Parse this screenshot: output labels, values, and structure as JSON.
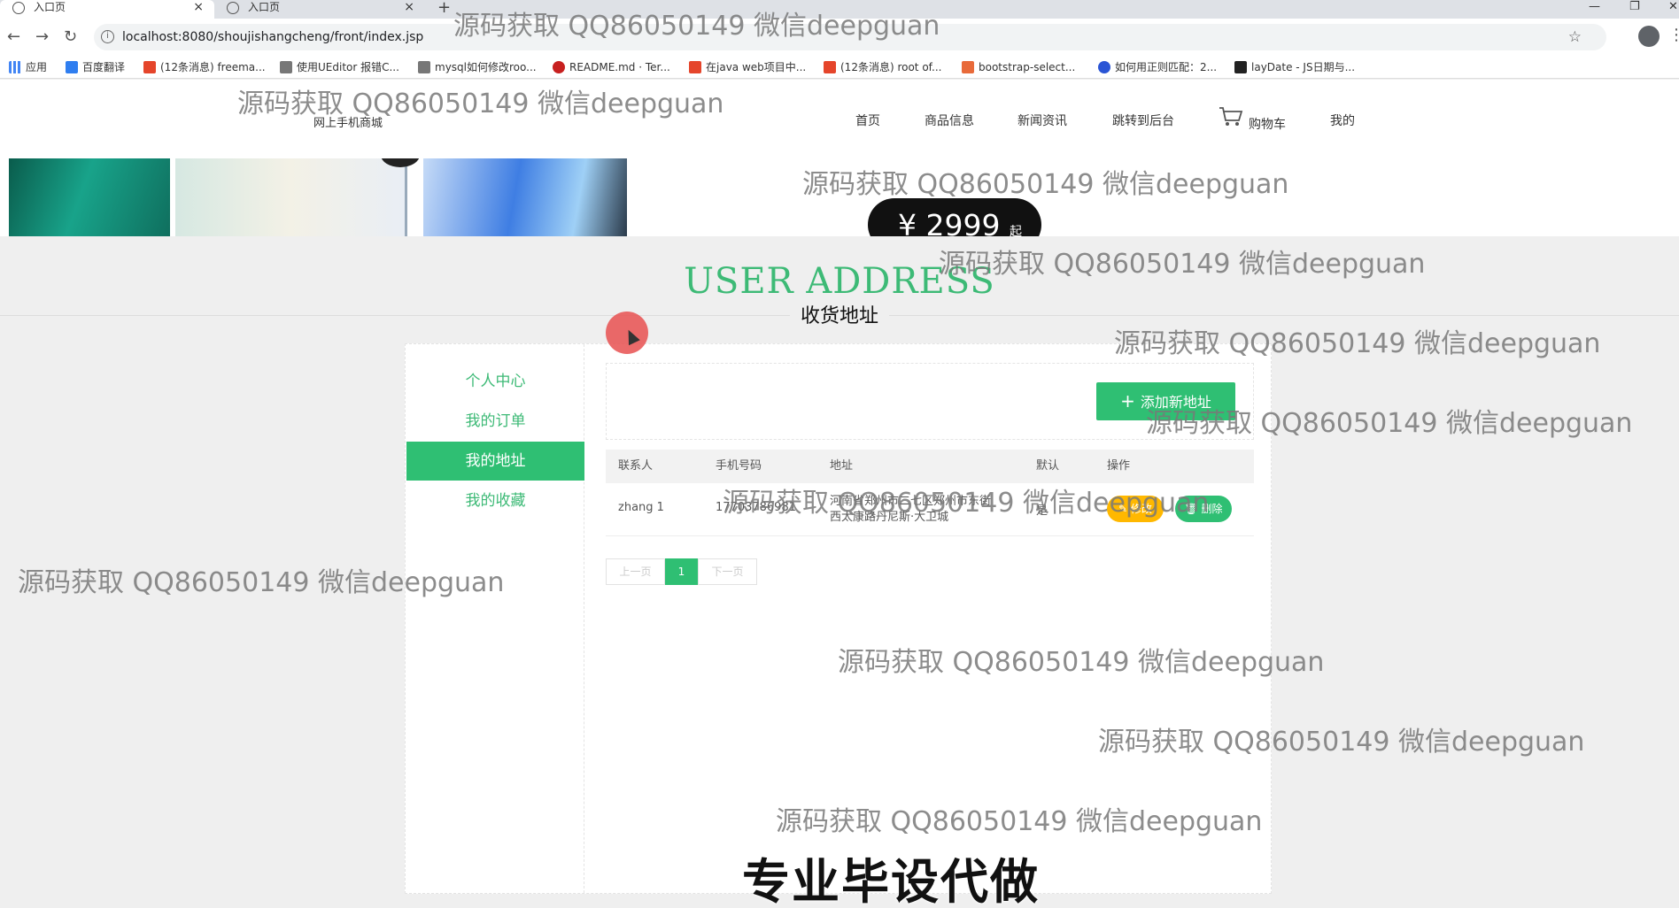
{
  "browser": {
    "tabs": [
      {
        "label": "入口页"
      },
      {
        "label": "入口页"
      }
    ],
    "url": "localhost:8080/shoujishangcheng/front/index.jsp",
    "bookmarks": [
      {
        "label": "应用",
        "color": "#4285f4"
      },
      {
        "label": "百度翻译",
        "color": "#2f7ef0"
      },
      {
        "label": "(12条消息) freema...",
        "color": "#e5452b"
      },
      {
        "label": "使用UEditor 报错C...",
        "color": "#555555"
      },
      {
        "label": "mysql如何修改roo...",
        "color": "#555555"
      },
      {
        "label": "README.md · Ter...",
        "color": "#c7201f"
      },
      {
        "label": "在java web项目中...",
        "color": "#e5452b"
      },
      {
        "label": "(12条消息) root of...",
        "color": "#e5452b"
      },
      {
        "label": "bootstrap-select...",
        "color": "#e86a3a"
      },
      {
        "label": "如何用正则匹配：2...",
        "color": "#2a55d5"
      },
      {
        "label": "layDate - JS日期与...",
        "color": "#222222"
      }
    ]
  },
  "site": {
    "brand": "网上手机商城",
    "nav": [
      "首页",
      "商品信息",
      "新闻资讯",
      "跳转到后台",
      "购物车",
      "我的"
    ]
  },
  "banner": {
    "price": "¥ 2999",
    "price_suffix": "起"
  },
  "section": {
    "title_en": "USER ADDRESS",
    "title_cn": "收货地址"
  },
  "sidebar": {
    "items": [
      {
        "label": "个人中心"
      },
      {
        "label": "我的订单"
      },
      {
        "label": "我的地址"
      },
      {
        "label": "我的收藏"
      }
    ]
  },
  "toolbar": {
    "add_label": "添加新地址"
  },
  "table": {
    "headers": [
      "联系人",
      "手机号码",
      "地址",
      "默认",
      "操作"
    ],
    "rows": [
      {
        "contact": "zhang 1",
        "phone": "17703786981",
        "address_line1": "河南省郑州市二七区郑州市东街",
        "address_line2": "西太康路丹尼斯·大卫城",
        "default": "是",
        "edit_label": "修改",
        "delete_label": "删除"
      }
    ]
  },
  "pagination": {
    "prev": "上一页",
    "current": "1",
    "next": "下一页"
  },
  "overlay": {
    "watermark": "源码获取 QQ86050149 微信deepguan",
    "footer_banner": "专业毕设代做"
  },
  "colors": {
    "accent": "#2fbf73",
    "heading": "#3dba76",
    "edit": "#ffb800"
  }
}
